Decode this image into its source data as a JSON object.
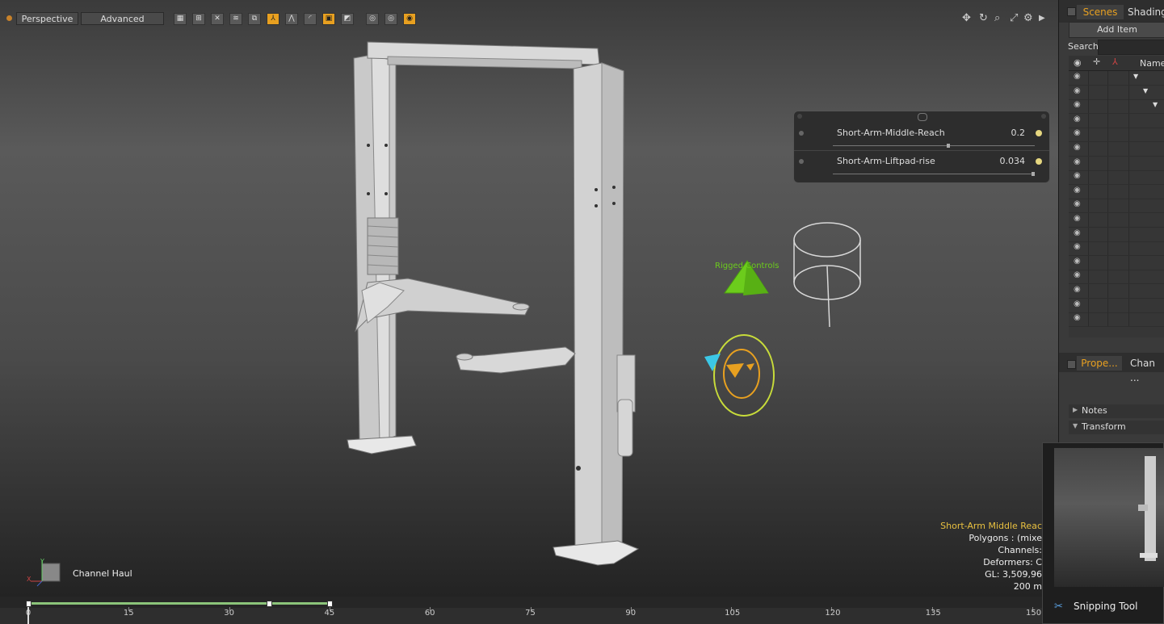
{
  "viewport": {
    "view_mode": "Perspective",
    "style_mode": "Advanced",
    "rigged_label": "Rigged Controls",
    "channel_haul_label": "Channel Haul"
  },
  "sliders": [
    {
      "label": "Short-Arm-Middle-Reach",
      "value": "0.2",
      "fraction": 0.57
    },
    {
      "label": "Short-Arm-Liftpad-rise",
      "value": "0.034",
      "fraction": 0.99
    }
  ],
  "info_overlay": {
    "item_name": "Short-Arm Middle Reac",
    "polygons": "Polygons : (mixe",
    "channels": "Channels:",
    "deformers": "Deformers: C",
    "gl": "GL: 3,509,96",
    "size": "200 m"
  },
  "timeline": {
    "ticks": [
      "0",
      "15",
      "30",
      "45",
      "60",
      "75",
      "90",
      "105",
      "120",
      "135",
      "150"
    ],
    "range_end_fraction": 0.3
  },
  "right_panel": {
    "tabs": [
      "Scenes",
      "Shading"
    ],
    "add_item": "Add Item",
    "search_label": "Search",
    "name_header": "Name",
    "bottom_tabs": [
      "Prope...",
      "Chan ..."
    ],
    "sections": [
      "Notes",
      "Transform"
    ]
  },
  "snipping": {
    "label": "Snipping Tool"
  },
  "colors": {
    "accent": "#e8a020",
    "rig_green": "#6ccc1c",
    "rig_yellow_green": "#c8dc3a",
    "rig_cyan": "#3cc8e6"
  }
}
